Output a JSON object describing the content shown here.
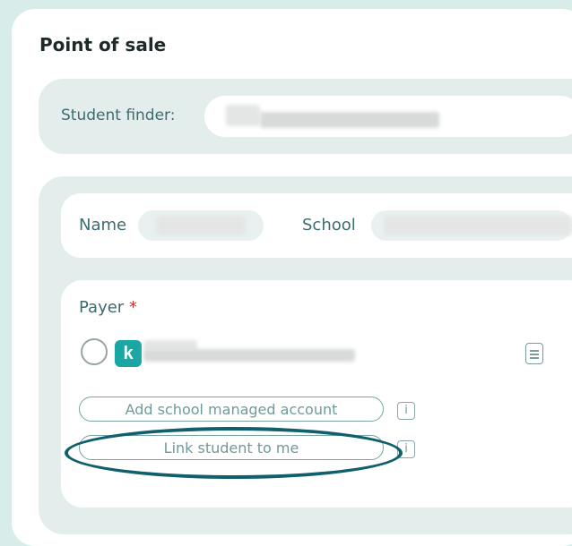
{
  "page": {
    "title": "Point of sale"
  },
  "finder": {
    "label": "Student finder:",
    "value": ""
  },
  "student": {
    "name_label": "Name",
    "name_value": "",
    "school_label": "School",
    "school_value": ""
  },
  "payer": {
    "label": "Payer",
    "required_mark": "*",
    "account_badge": "k",
    "account_name": "",
    "icons": [
      "radio-circle",
      "document-icon",
      "info-icon"
    ]
  },
  "actions": {
    "add_school_managed": "Add school managed account",
    "link_student": "Link student to me",
    "info_glyph": "i"
  },
  "colors": {
    "background": "#d8ecea",
    "panel": "#e3eeec",
    "accent": "#1aa7a4",
    "highlight": "#0f5f6c",
    "required": "#d0312d"
  }
}
